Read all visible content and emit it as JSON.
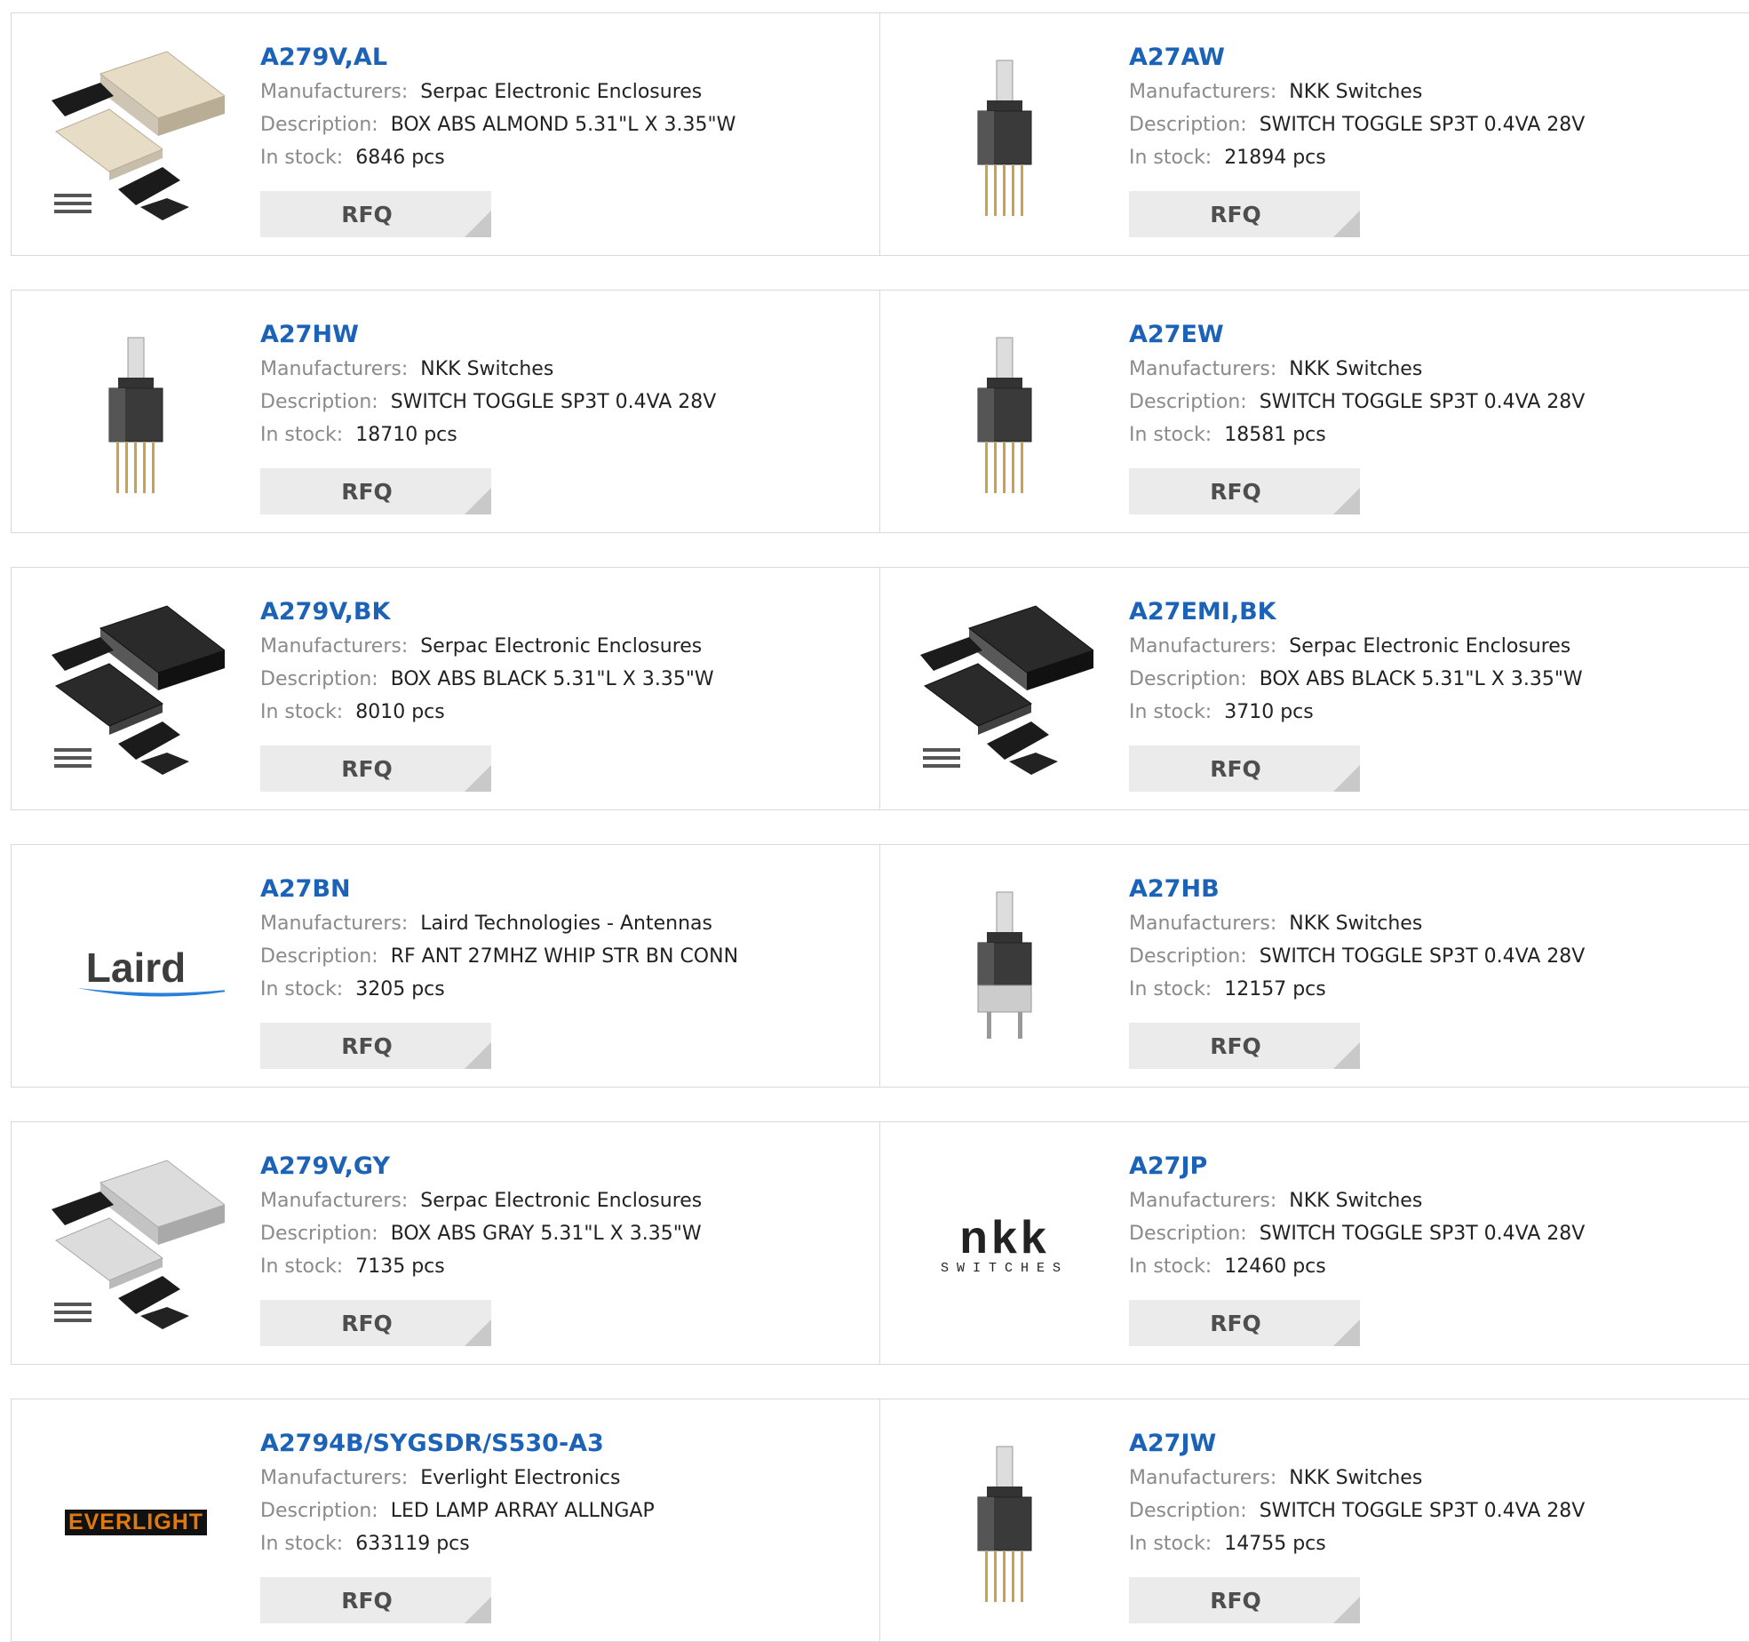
{
  "labels": {
    "manufacturers": "Manufacturers:",
    "description": "Description:",
    "in_stock": "In stock:",
    "rfq": "RFQ"
  },
  "colors": {
    "part_link": "#1c63b7",
    "label_gray": "#8a8a8a",
    "rfq_bg": "#ebebeb"
  },
  "products": [
    {
      "part": "A279V,AL",
      "manufacturer": "Serpac Electronic Enclosures",
      "description": "BOX ABS ALMOND 5.31\"L X 3.35\"W",
      "stock": "6846 pcs",
      "image": "enclosure-almond"
    },
    {
      "part": "A27AW",
      "manufacturer": "NKK Switches",
      "description": "SWITCH TOGGLE SP3T 0.4VA 28V",
      "stock": "21894 pcs",
      "image": "toggle-switch"
    },
    {
      "part": "A27HW",
      "manufacturer": "NKK Switches",
      "description": "SWITCH TOGGLE SP3T 0.4VA 28V",
      "stock": "18710 pcs",
      "image": "toggle-switch"
    },
    {
      "part": "A27EW",
      "manufacturer": "NKK Switches",
      "description": "SWITCH TOGGLE SP3T 0.4VA 28V",
      "stock": "18581 pcs",
      "image": "toggle-switch"
    },
    {
      "part": "A279V,BK",
      "manufacturer": "Serpac Electronic Enclosures",
      "description": "BOX ABS BLACK 5.31\"L X 3.35\"W",
      "stock": "8010 pcs",
      "image": "enclosure-black"
    },
    {
      "part": "A27EMI,BK",
      "manufacturer": "Serpac Electronic Enclosures",
      "description": "BOX ABS BLACK 5.31\"L X 3.35\"W",
      "stock": "3710 pcs",
      "image": "enclosure-black-emi"
    },
    {
      "part": "A27BN",
      "manufacturer": "Laird Technologies - Antennas",
      "description": "RF ANT 27MHZ WHIP STR BN CONN",
      "stock": "3205 pcs",
      "image": "laird-logo"
    },
    {
      "part": "A27HB",
      "manufacturer": "NKK Switches",
      "description": "SWITCH TOGGLE SP3T 0.4VA 28V",
      "stock": "12157 pcs",
      "image": "toggle-switch-bracket"
    },
    {
      "part": "A279V,GY",
      "manufacturer": "Serpac Electronic Enclosures",
      "description": "BOX ABS GRAY 5.31\"L X 3.35\"W",
      "stock": "7135 pcs",
      "image": "enclosure-gray"
    },
    {
      "part": "A27JP",
      "manufacturer": "NKK Switches",
      "description": "SWITCH TOGGLE SP3T 0.4VA 28V",
      "stock": "12460 pcs",
      "image": "nkk-logo"
    },
    {
      "part": "A2794B/SYGSDR/S530-A3",
      "manufacturer": "Everlight Electronics",
      "description": "LED LAMP ARRAY ALLNGAP",
      "stock": "633119 pcs",
      "image": "everlight-logo"
    },
    {
      "part": "A27JW",
      "manufacturer": "NKK Switches",
      "description": "SWITCH TOGGLE SP3T 0.4VA 28V",
      "stock": "14755 pcs",
      "image": "toggle-switch"
    }
  ],
  "logos": {
    "laird": "Laird",
    "nkk_big": "nkk",
    "nkk_small": "SWITCHES",
    "everlight": "EVERLIGHT"
  }
}
